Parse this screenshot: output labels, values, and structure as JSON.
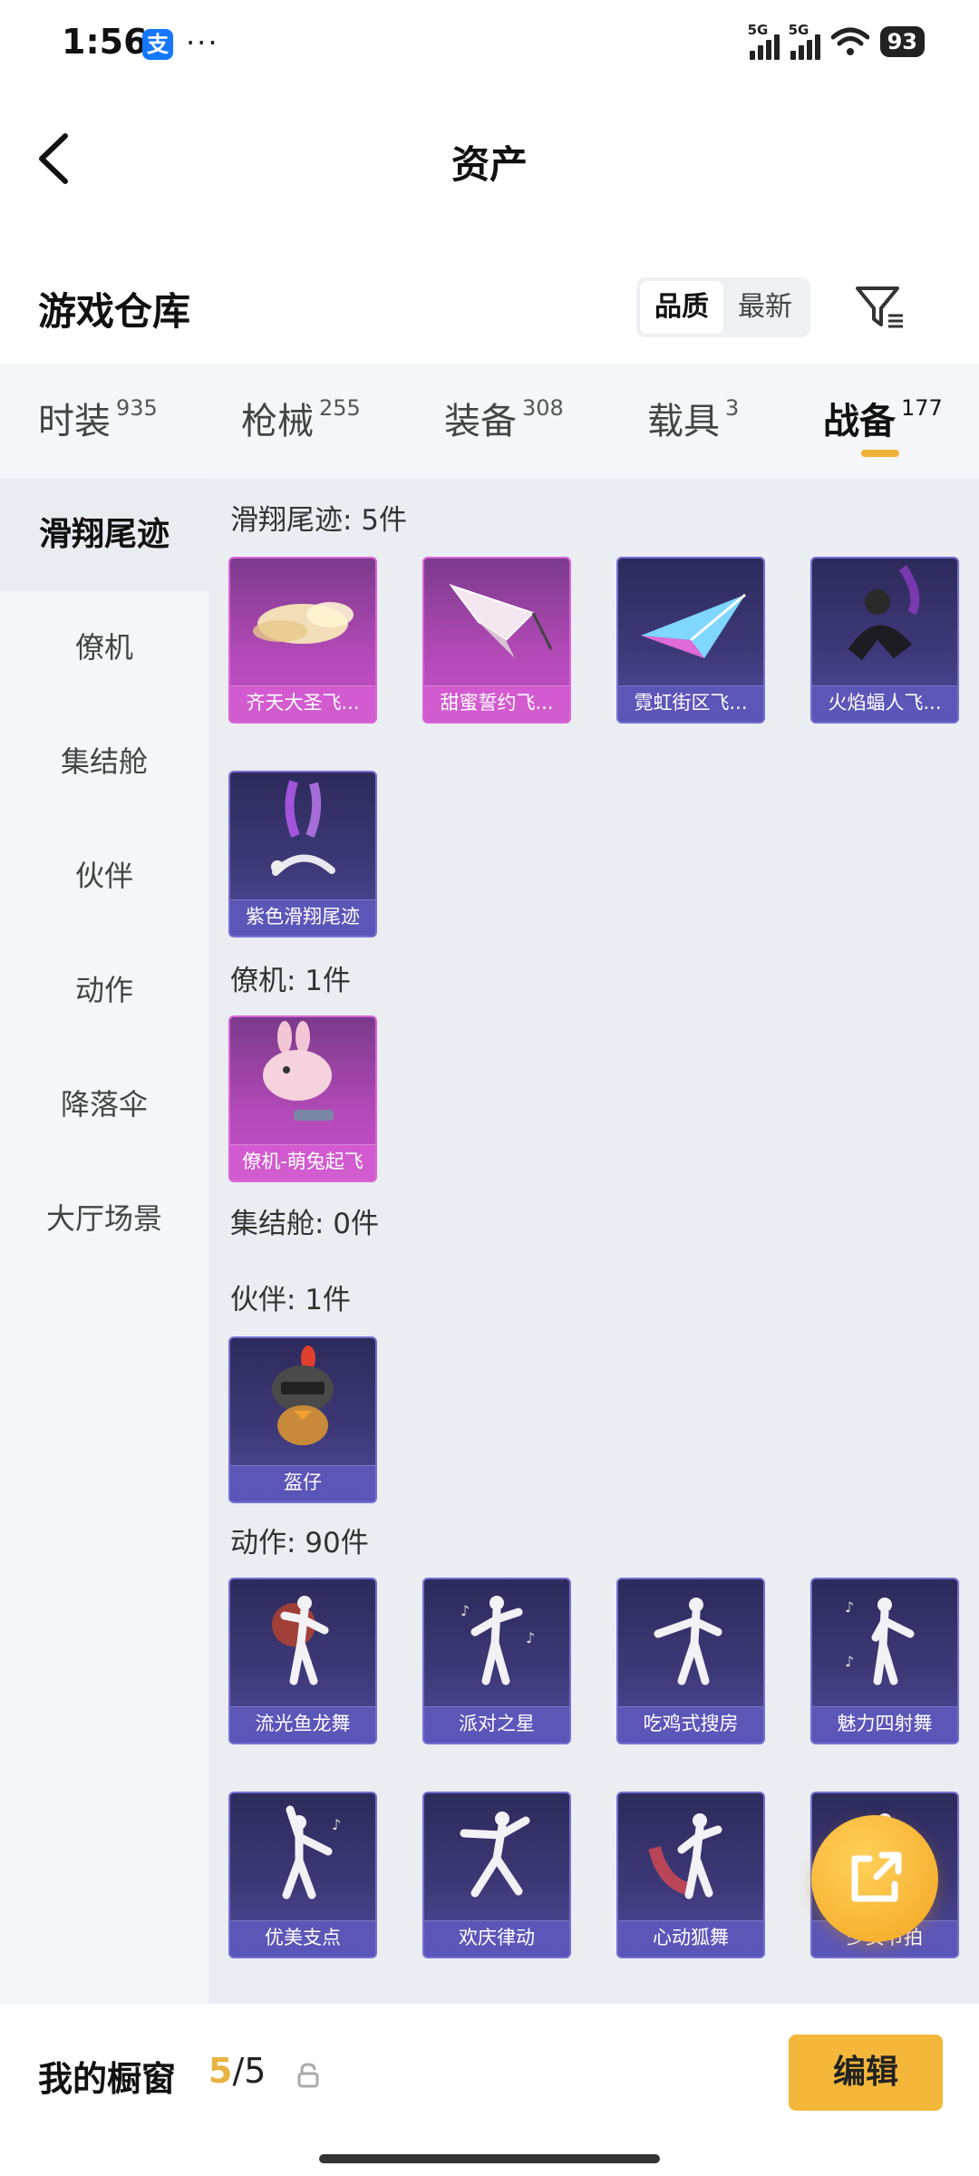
{
  "status_bar": {
    "time": "1:56",
    "alipay_badge": "支",
    "more": "···",
    "network1": "5G",
    "network2": "5G",
    "battery": "93"
  },
  "header": {
    "title": "资产"
  },
  "warehouse": {
    "title": "游戏仓库",
    "sort_options": [
      "品质",
      "最新"
    ],
    "active_sort": "品质"
  },
  "category_tabs": [
    {
      "label": "时装",
      "count": "935"
    },
    {
      "label": "枪械",
      "count": "255"
    },
    {
      "label": "装备",
      "count": "308"
    },
    {
      "label": "载具",
      "count": "3"
    },
    {
      "label": "战备",
      "count": "177",
      "active": true
    }
  ],
  "sidebar": {
    "items": [
      "滑翔尾迹",
      "僚机",
      "集结舱",
      "伙伴",
      "动作",
      "降落伞",
      "大厅场景"
    ],
    "active": "滑翔尾迹"
  },
  "sections": [
    {
      "title": "滑翔尾迹: 5件",
      "items": [
        {
          "name": "齐天大圣飞...",
          "quality": "pink",
          "icon": "golden-cloud-icon"
        },
        {
          "name": "甜蜜誓约飞...",
          "quality": "pink",
          "icon": "paper-plane-icon"
        },
        {
          "name": "霓虹街区飞...",
          "quality": "purple",
          "icon": "neon-plane-icon"
        },
        {
          "name": "火焰蝠人飞...",
          "quality": "purple",
          "icon": "bat-wing-icon"
        },
        {
          "name": "紫色滑翔尾迹",
          "quality": "purple",
          "icon": "purple-smoke-icon"
        }
      ]
    },
    {
      "title": "僚机: 1件",
      "items": [
        {
          "name": "僚机-萌兔起飞",
          "quality": "pink",
          "icon": "bunny-drone-icon"
        }
      ]
    },
    {
      "title": "集结舱: 0件",
      "items": []
    },
    {
      "title": "伙伴: 1件",
      "items": [
        {
          "name": "盔仔",
          "quality": "purple",
          "icon": "helmet-chick-icon"
        }
      ]
    },
    {
      "title": "动作: 90件",
      "items": [
        {
          "name": "流光鱼龙舞",
          "quality": "purple",
          "icon": "dance-pose-icon"
        },
        {
          "name": "派对之星",
          "quality": "purple",
          "icon": "dance-pose-icon"
        },
        {
          "name": "吃鸡式搜房",
          "quality": "purple",
          "icon": "dance-pose-icon"
        },
        {
          "name": "魅力四射舞",
          "quality": "purple",
          "icon": "dance-pose-icon"
        },
        {
          "name": "优美支点",
          "quality": "purple",
          "icon": "dance-pose-icon"
        },
        {
          "name": "欢庆律动",
          "quality": "purple",
          "icon": "dance-pose-icon"
        },
        {
          "name": "心动狐舞",
          "quality": "purple",
          "icon": "dance-pose-icon"
        },
        {
          "name": "少女节拍",
          "quality": "purple",
          "icon": "dance-pose-icon"
        }
      ]
    }
  ],
  "bottom_bar": {
    "title": "我的橱窗",
    "current": "5",
    "separator": "/",
    "max": "5",
    "edit_label": "编辑"
  },
  "colors": {
    "accent": "#f4b73a",
    "pink_quality": "#c650c7",
    "purple_quality": "#5a55b8"
  }
}
